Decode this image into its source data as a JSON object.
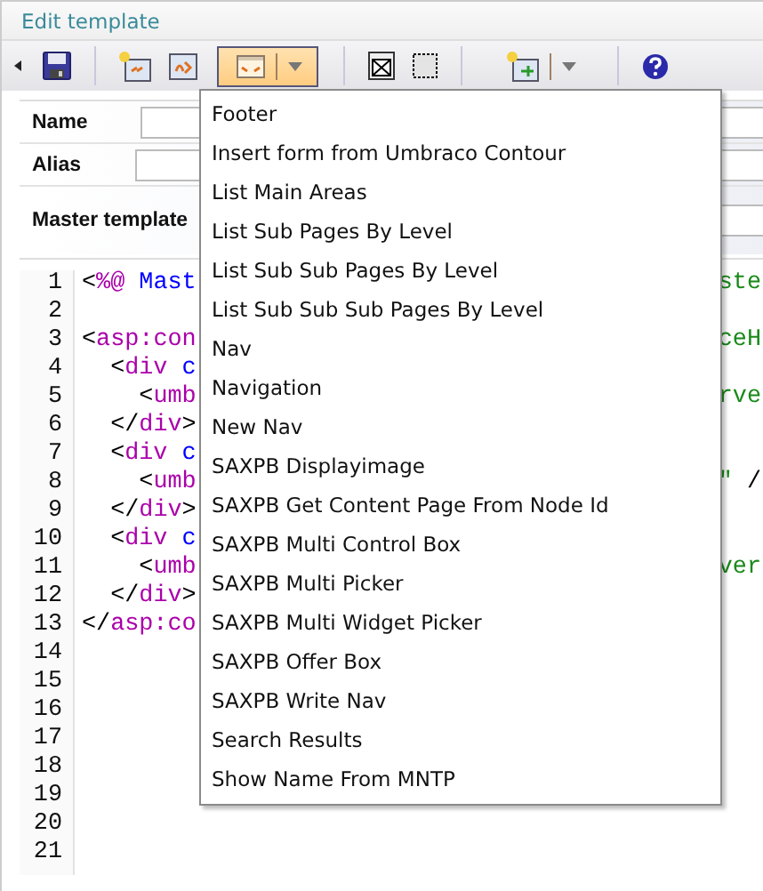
{
  "header": {
    "title": "Edit template"
  },
  "toolbar": {
    "buttons": [
      {
        "kind": "collapse",
        "pressed": false
      },
      {
        "kind": "save",
        "pressed": false
      },
      {
        "kind": "separator"
      },
      {
        "kind": "insert-field",
        "pressed": false
      },
      {
        "kind": "insert-xslt",
        "pressed": false
      },
      {
        "kind": "macro-split",
        "pressed": true
      },
      {
        "kind": "separator"
      },
      {
        "kind": "placeholder",
        "pressed": false
      },
      {
        "kind": "area",
        "pressed": false
      },
      {
        "kind": "separator"
      },
      {
        "kind": "insert-split",
        "pressed": false
      },
      {
        "kind": "separator"
      },
      {
        "kind": "help",
        "pressed": false
      }
    ]
  },
  "form": {
    "fields": [
      {
        "label": "Name"
      },
      {
        "label": "Alias"
      },
      {
        "label": "Master template"
      }
    ]
  },
  "editor": {
    "lines": [
      {
        "number": "1",
        "left": [
          {
            "text": "<",
            "kind": "punct"
          },
          {
            "text": "%@",
            "kind": "directive"
          },
          {
            "text": " Mast",
            "kind": "attr"
          }
        ],
        "right": [
          {
            "text": "ste",
            "kind": "value"
          }
        ]
      },
      {
        "number": "2"
      },
      {
        "number": "3",
        "left": [
          {
            "text": "<",
            "kind": "punct"
          },
          {
            "text": "asp:con",
            "kind": "tag"
          }
        ],
        "right": [
          {
            "text": "ceH",
            "kind": "value"
          }
        ]
      },
      {
        "number": "4",
        "left": [
          {
            "text": "  <",
            "kind": "punct"
          },
          {
            "text": "div",
            "kind": "tag"
          },
          {
            "text": " c",
            "kind": "attr"
          }
        ]
      },
      {
        "number": "5",
        "left": [
          {
            "text": "    <",
            "kind": "punct"
          },
          {
            "text": "umb",
            "kind": "tag"
          }
        ],
        "right": [
          {
            "text": "rve",
            "kind": "value"
          }
        ]
      },
      {
        "number": "6",
        "left": [
          {
            "text": "  </",
            "kind": "punct"
          },
          {
            "text": "div",
            "kind": "tag"
          },
          {
            "text": ">",
            "kind": "punct"
          }
        ]
      },
      {
        "number": "7",
        "left": [
          {
            "text": "  <",
            "kind": "punct"
          },
          {
            "text": "div",
            "kind": "tag"
          },
          {
            "text": " c",
            "kind": "attr"
          }
        ]
      },
      {
        "number": "8",
        "left": [
          {
            "text": "    <",
            "kind": "punct"
          },
          {
            "text": "umb",
            "kind": "tag"
          }
        ],
        "right": [
          {
            "text": "\"",
            "kind": "value"
          },
          {
            "text": " /",
            "kind": "punct"
          }
        ]
      },
      {
        "number": "9",
        "left": [
          {
            "text": "  </",
            "kind": "punct"
          },
          {
            "text": "div",
            "kind": "tag"
          },
          {
            "text": ">",
            "kind": "punct"
          }
        ]
      },
      {
        "number": "10",
        "left": [
          {
            "text": "  <",
            "kind": "punct"
          },
          {
            "text": "div",
            "kind": "tag"
          },
          {
            "text": " c",
            "kind": "attr"
          }
        ]
      },
      {
        "number": "11",
        "left": [
          {
            "text": "    <",
            "kind": "punct"
          },
          {
            "text": "umb",
            "kind": "tag"
          }
        ],
        "right": [
          {
            "text": "ver",
            "kind": "value"
          }
        ]
      },
      {
        "number": "12",
        "left": [
          {
            "text": "  </",
            "kind": "punct"
          },
          {
            "text": "div",
            "kind": "tag"
          },
          {
            "text": ">",
            "kind": "punct"
          }
        ]
      },
      {
        "number": "13",
        "left": [
          {
            "text": "</",
            "kind": "punct"
          },
          {
            "text": "asp:co",
            "kind": "tag"
          }
        ]
      },
      {
        "number": "14"
      },
      {
        "number": "15"
      },
      {
        "number": "16"
      },
      {
        "number": "17"
      },
      {
        "number": "18"
      },
      {
        "number": "19"
      },
      {
        "number": "20"
      },
      {
        "number": "21"
      }
    ]
  },
  "menu": {
    "items": [
      "Footer",
      "Insert form from Umbraco Contour",
      "List Main Areas",
      "List Sub Pages By Level",
      "List Sub Sub Pages By Level",
      "List Sub Sub Sub Pages By Level",
      "Nav",
      "Navigation",
      "New Nav",
      "SAXPB Displayimage",
      "SAXPB Get Content Page From Node Id",
      "SAXPB Multi Control Box",
      "SAXPB Multi Picker",
      "SAXPB Multi Widget Picker",
      "SAXPB Offer Box",
      "SAXPB Write Nav",
      "Search Results",
      "Show Name From MNTP"
    ]
  }
}
